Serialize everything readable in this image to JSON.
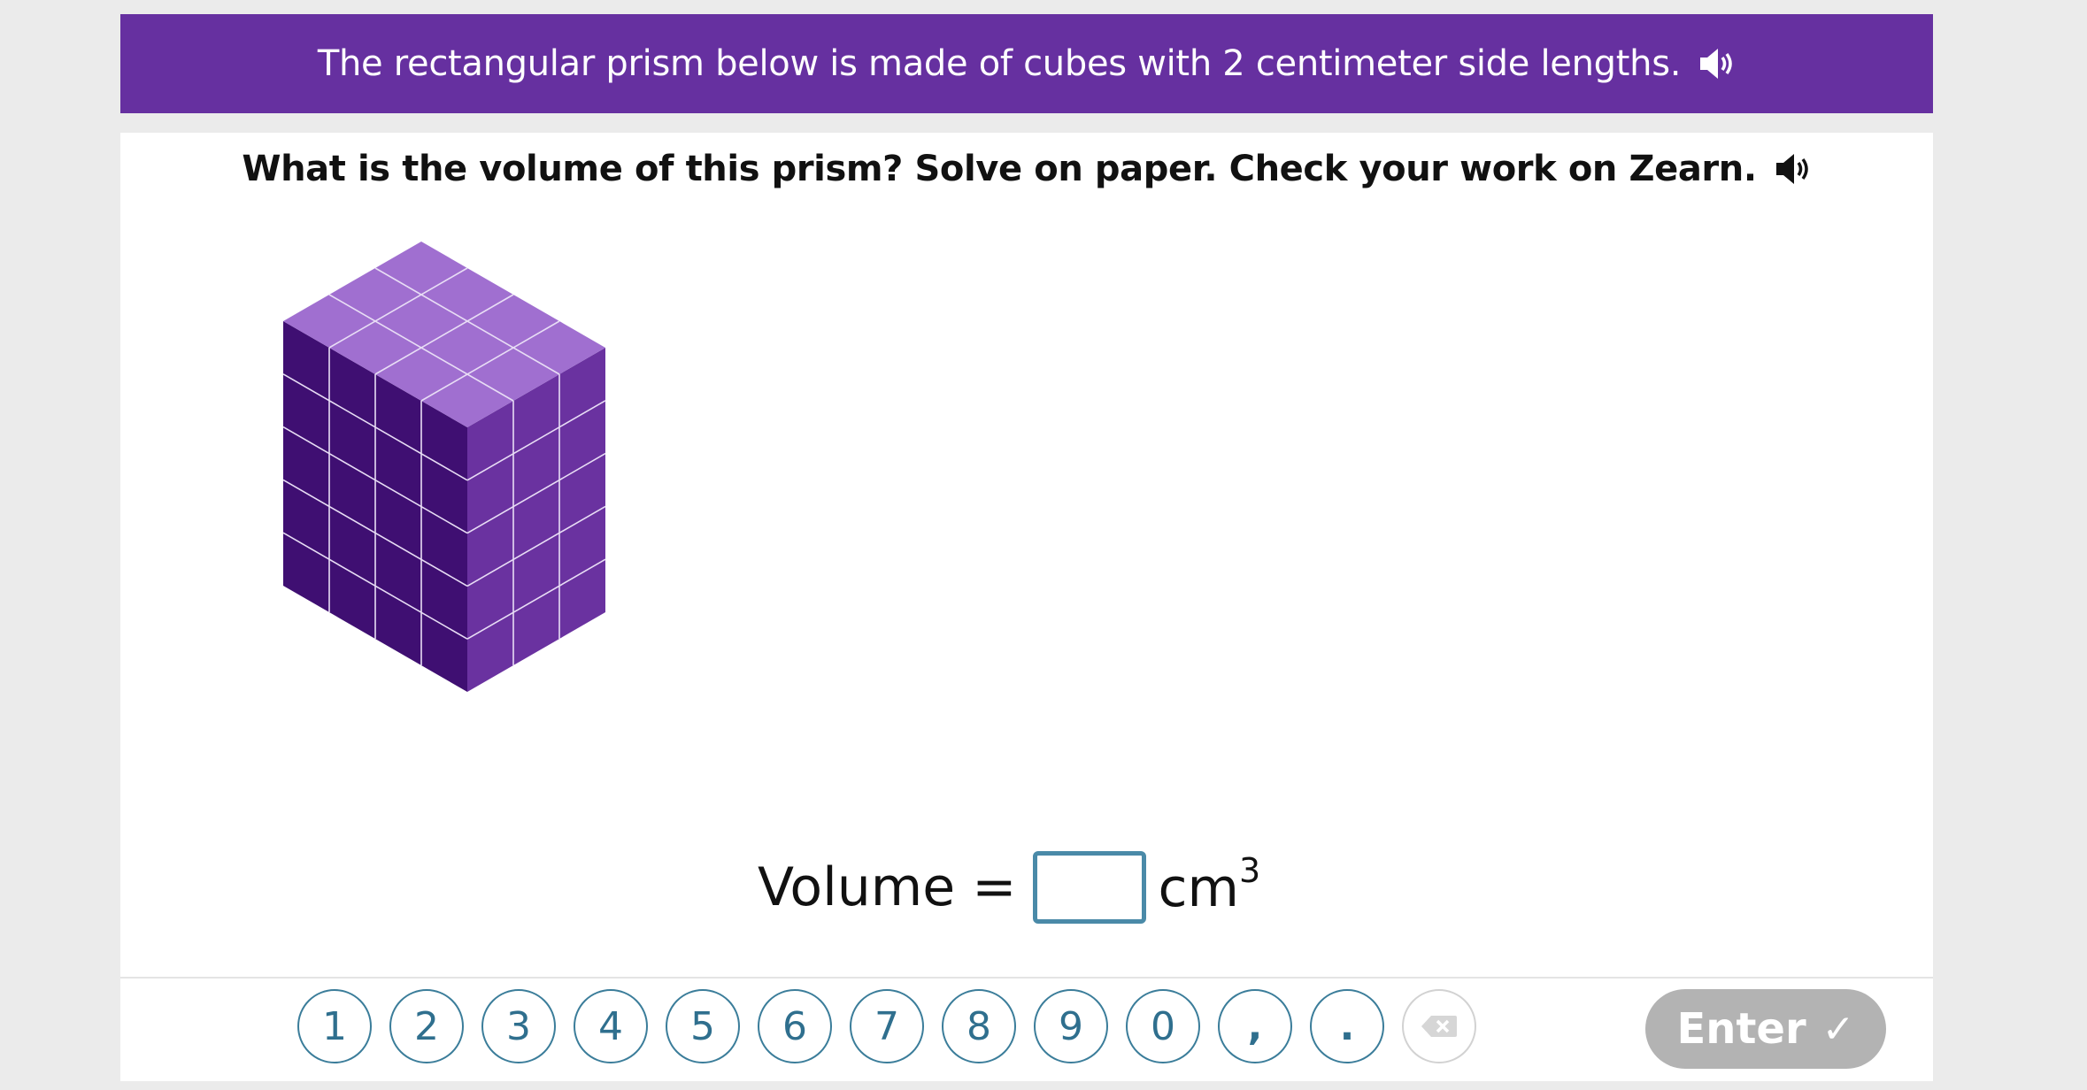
{
  "banner": {
    "text": "The rectangular prism below is made of cubes with 2 centimeter side lengths."
  },
  "question": {
    "text": "What is the volume of this prism? Solve on paper. Check your work on Zearn."
  },
  "answer": {
    "label": "Volume =",
    "value": "",
    "unit": "cm",
    "unit_exponent": "3"
  },
  "keypad": {
    "keys": [
      "1",
      "2",
      "3",
      "4",
      "5",
      "6",
      "7",
      "8",
      "9",
      "0",
      ",",
      "."
    ],
    "backspace_icon": "backspace-icon",
    "enter_label": "Enter",
    "enter_icon": "check-icon"
  },
  "prism": {
    "cubes_wide": 4,
    "cubes_deep": 3,
    "cubes_high": 5
  },
  "colors": {
    "banner": "#6630a0",
    "top_face": "#a06fd0",
    "left_face": "#3f0f72",
    "right_face": "#6a32a0",
    "accent": "#3b7d9a",
    "enter_disabled": "#b3b3b3"
  }
}
